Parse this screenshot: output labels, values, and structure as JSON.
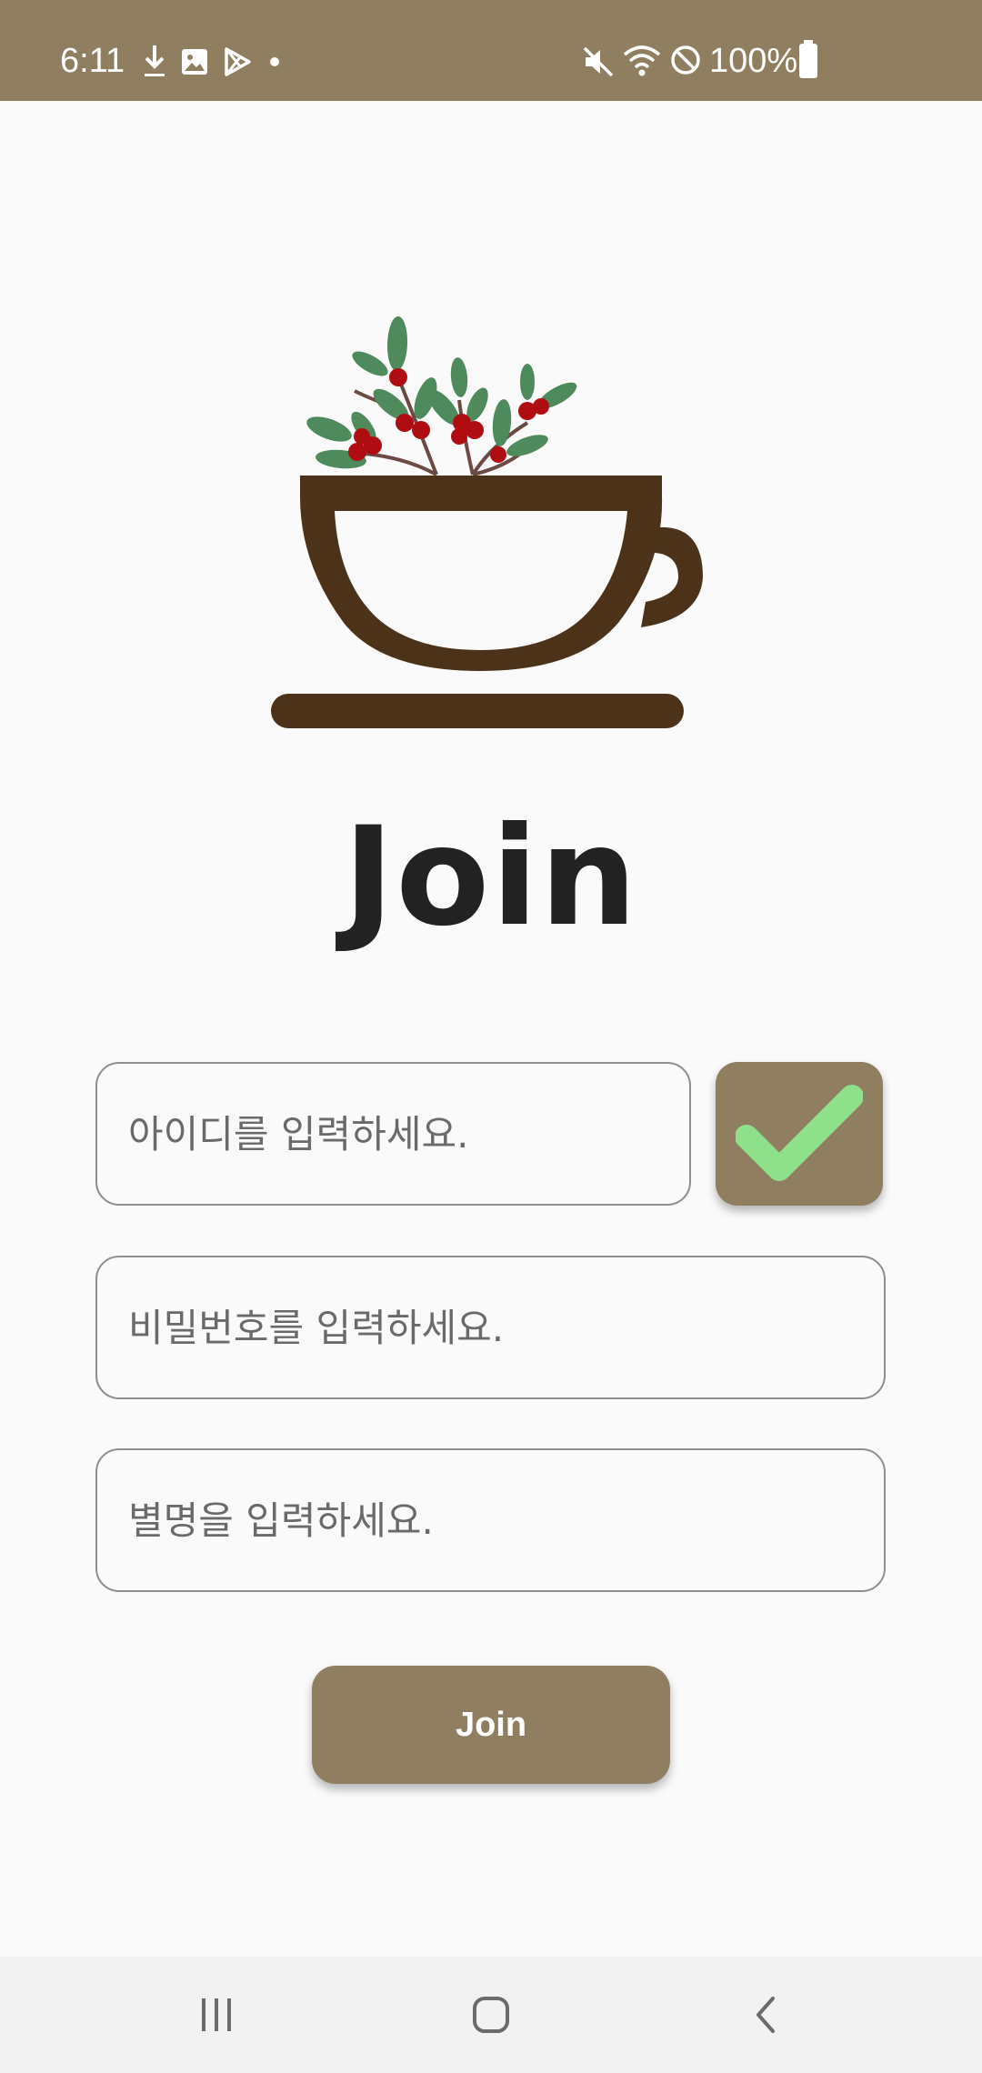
{
  "status_bar": {
    "time": "6:11",
    "battery": "100%",
    "left_icons": [
      "download-icon",
      "image-icon",
      "play-store-icon",
      "dot-icon"
    ],
    "right_icons": [
      "mute-icon",
      "wifi-icon",
      "do-not-disturb-icon",
      "battery-icon"
    ]
  },
  "title": "Join",
  "form": {
    "id_placeholder": "아이디를 입력하세요.",
    "password_placeholder": "비밀번호를 입력하세요.",
    "nickname_placeholder": "별명을 입력하세요.",
    "check_icon": "check-icon",
    "join_label": "Join"
  },
  "nav_bar": {
    "buttons": [
      "recent-apps-icon",
      "home-icon",
      "back-icon"
    ]
  },
  "colors": {
    "accent": "#8f7e5f",
    "cup": "#4b3219",
    "check": "#8fe08b",
    "leaf": "#4e8a5c",
    "berry": "#b00d12"
  }
}
